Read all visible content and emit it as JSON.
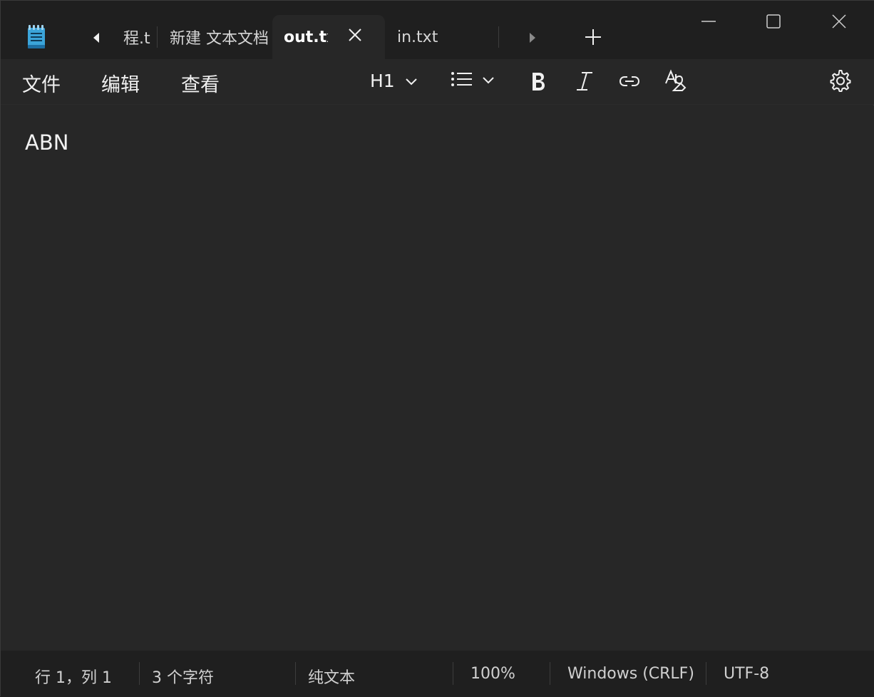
{
  "tabs": [
    {
      "label": "程.t"
    },
    {
      "label": "新建 文本文档"
    },
    {
      "label": "out.txt",
      "active": true
    },
    {
      "label": "in.txt"
    }
  ],
  "menu": {
    "file": "文件",
    "edit": "编辑",
    "view": "查看"
  },
  "toolbar": {
    "heading_value": "H1",
    "icons": [
      "list-icon",
      "bold-icon",
      "italic-icon",
      "link-icon",
      "spell-check-icon",
      "settings-icon"
    ]
  },
  "editor": {
    "content": "ABN"
  },
  "status": {
    "position": "行 1，列 1",
    "char_count": "3 个字符",
    "format": "纯文本",
    "zoom": "100%",
    "line_ending": "Windows (CRLF)",
    "encoding": "UTF-8"
  },
  "colors": {
    "background": "#272727",
    "titlebar": "#1f1f1f",
    "accent_icon": "#3ba4d9"
  }
}
